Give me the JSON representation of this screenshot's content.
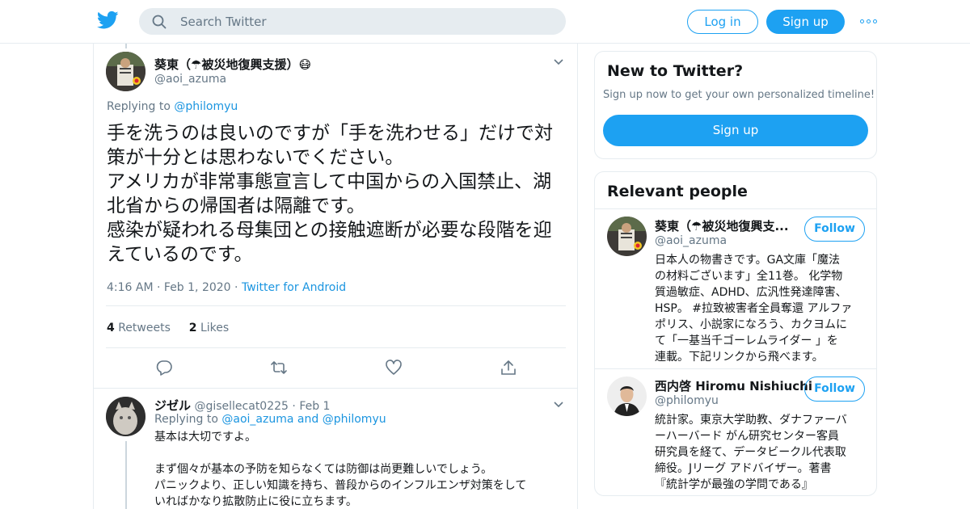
{
  "header": {
    "search_placeholder": "Search Twitter",
    "login_label": "Log in",
    "signup_label": "Sign up"
  },
  "tweet": {
    "author_name": "葵東（☂被災地復興支援）😷",
    "author_handle": "@aoi_azuma",
    "replying_prefix": "Replying to",
    "replying_to": "@philomyu",
    "text_lines": [
      "手を洗うのは良いのですが「手を洗わせる」だけで対",
      "策が十分とは思わないでください。",
      "アメリカが非常事態宣言して中国からの入国禁止、湖",
      "北省からの帰国者は隔離です。",
      "感染が疑われる母集団との接触遮断が必要な段階を迎",
      "えているのです。"
    ],
    "time": "4:16 AM",
    "date": "Feb 1, 2020",
    "source": "Twitter for Android",
    "sep": "·",
    "retweets_count": "4",
    "retweets_label": "Retweets",
    "likes_count": "2",
    "likes_label": "Likes"
  },
  "reply": {
    "author_name": "ジゼル",
    "author_handle": "@gisellecat0225",
    "sep": "·",
    "date": "Feb 1",
    "replying_prefix": "Replying to",
    "replying_to_1": "@aoi_azuma",
    "and_word": "and",
    "replying_to_2": "@philomyu",
    "text_lines": [
      "基本は大切ですよ。",
      "",
      "まず個々が基本の予防を知らなくては防御は尚更難しいでしょう。",
      "パニックより、正しい知識を持ち、普段からのインフルエンザ対策をして",
      "いればかなり拡散防止に役に立ちます。"
    ]
  },
  "new_to_twitter": {
    "title": "New to Twitter?",
    "subtitle": "Sign up now to get your own personalized timeline!",
    "signup_label": "Sign up"
  },
  "relevant_people": {
    "title": "Relevant people",
    "people": [
      {
        "name": "葵東（☂被災地復興支...",
        "handle": "@aoi_azuma",
        "follow_label": "Follow",
        "bio_lines": [
          "日本人の物書きです。GA文庫「魔法",
          "の材料ございます」全11巻。 化学物",
          "質過敏症、ADHD、広汎性発達障害、",
          "HSP。 #拉致被害者全員奪還 アルファ",
          "ポリス、小説家になろう、カクヨムに",
          "て「一基当千ゴーレムライダー 」を",
          "連載。下記リンクから飛べます。"
        ]
      },
      {
        "name": "西内啓 Hiromu Nishiuchi",
        "handle": "@philomyu",
        "follow_label": "Follow",
        "bio_lines": [
          "統計家。東京大学助教、ダナファーバ",
          "ーハーバード がん研究センター客員",
          "研究員を経て、データビークル代表取",
          "締役。Jリーグ アドバイザー。著書",
          "『統計学が最強の学問である』"
        ]
      }
    ]
  },
  "colors": {
    "accent": "#1da1f2",
    "link": "#1b95e0",
    "muted": "#657786",
    "border": "#e6ecf0"
  }
}
